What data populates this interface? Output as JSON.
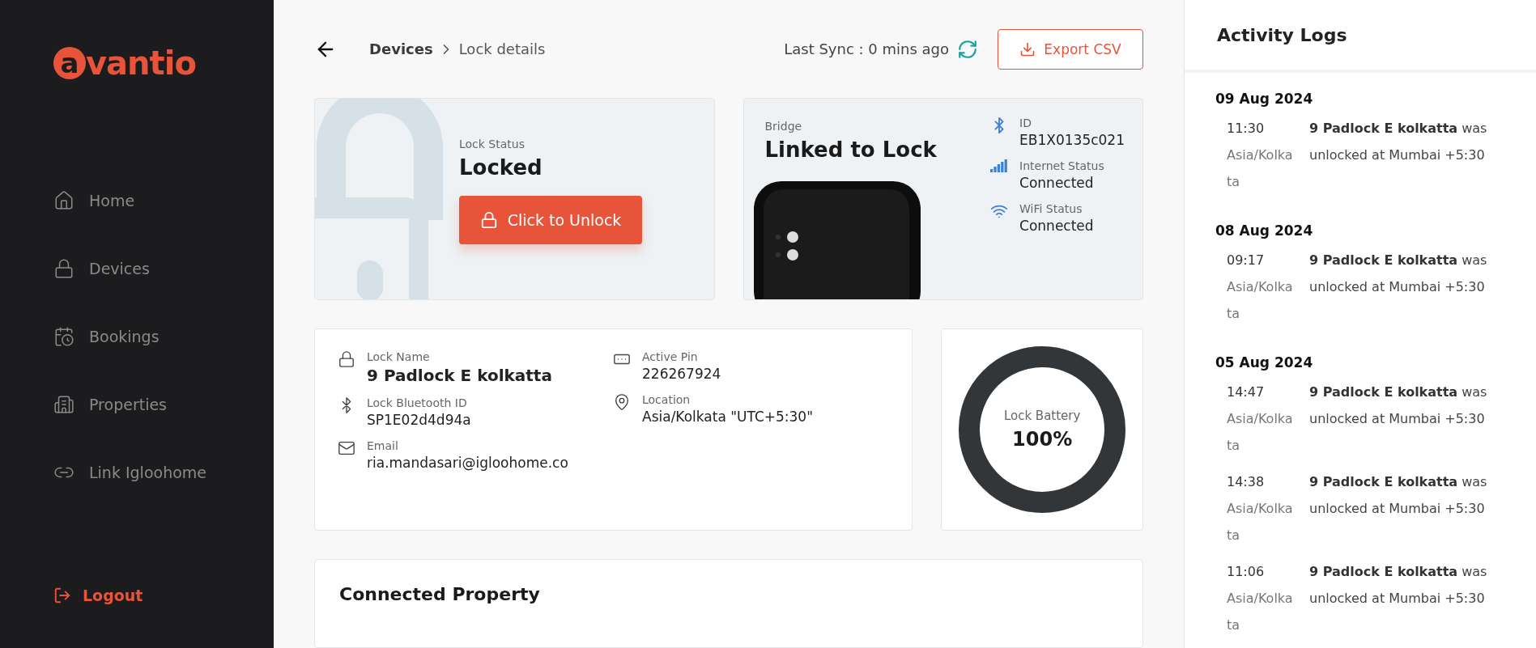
{
  "sidebar": {
    "logo": {
      "mark": "a",
      "text": "vantio"
    },
    "items": [
      {
        "label": "Home",
        "selected": false
      },
      {
        "label": "Devices",
        "selected": false
      },
      {
        "label": "Bookings",
        "selected": false
      },
      {
        "label": "Properties",
        "selected": false
      },
      {
        "label": "Link Igloohome",
        "selected": false
      }
    ],
    "logout": "Logout"
  },
  "header": {
    "breadcrumb": [
      "Devices",
      "Lock details"
    ],
    "last_sync": "Last Sync : 0 mins ago",
    "export_button": "Export CSV"
  },
  "lock_status": {
    "label": "Lock Status",
    "value": "Locked",
    "button": "Click to Unlock"
  },
  "bridge": {
    "label": "Bridge",
    "title": "Linked to Lock",
    "details": [
      {
        "label": "ID",
        "value": "EB1X0135c021"
      },
      {
        "label": "Internet Status",
        "value": "Connected"
      },
      {
        "label": "WiFi Status",
        "value": "Connected"
      }
    ]
  },
  "lock_info": {
    "fields": [
      {
        "label": "Lock Name",
        "value": "9 Padlock E kolkatta"
      },
      {
        "label": "Lock Bluetooth ID",
        "value": "SP1E02d4d94a"
      },
      {
        "label": "Email",
        "value": "ria.mandasari@igloohome.co"
      },
      {
        "label": "Active Pin",
        "value": "226267924"
      },
      {
        "label": "Location",
        "value": "Asia/Kolkata \"UTC+5:30\""
      }
    ]
  },
  "battery": {
    "label": "Lock Battery",
    "reading": "100%",
    "level": 1
  },
  "connected_property": {
    "title": "Connected Property"
  },
  "activity_logs": {
    "title": "Activity Logs",
    "days": [
      {
        "date": "09 Aug 2024",
        "entries": [
          {
            "time": "11:30",
            "zone": "Asia/Kolkata",
            "text": "**9 Padlock E kolkatta** was unlocked at Mumbai +5:30"
          }
        ]
      },
      {
        "date": "08 Aug 2024",
        "entries": [
          {
            "time": "09:17",
            "zone": "Asia/Kolkata",
            "text": "**9 Padlock E kolkatta** was unlocked at Mumbai +5:30"
          }
        ]
      },
      {
        "date": "05 Aug 2024",
        "entries": [
          {
            "time": "14:47",
            "zone": "Asia/Kolkata",
            "text": "**9 Padlock E kolkatta** was unlocked at Mumbai +5:30"
          },
          {
            "time": "14:38",
            "zone": "Asia/Kolkata",
            "text": "**9 Padlock E kolkatta** was unlocked at Mumbai +5:30"
          },
          {
            "time": "11:06",
            "zone": "Asia/Kolkata",
            "text": "**9 Padlock E kolkatta** was unlocked at Mumbai +5:30"
          }
        ]
      }
    ]
  }
}
